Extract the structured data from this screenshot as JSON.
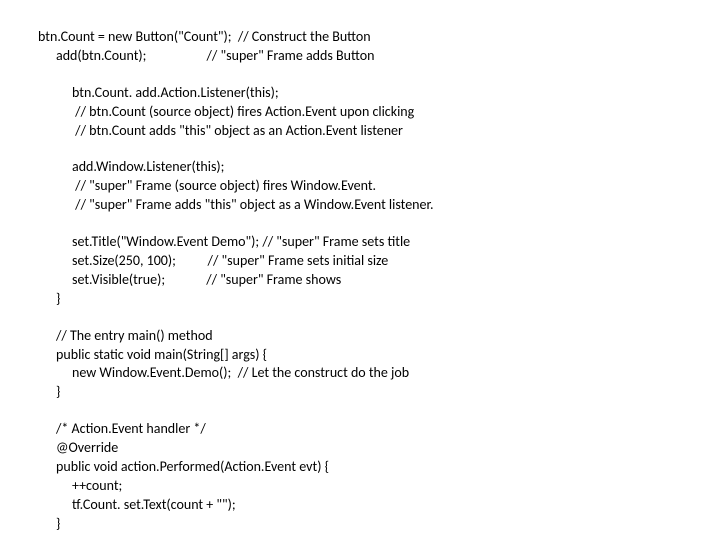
{
  "lines": [
    {
      "cls": "line",
      "text": "btn.Count = new Button(\"Count\");  // Construct the Button"
    },
    {
      "cls": "line ind1",
      "text": "add(btn.Count);                   // \"super\" Frame adds Button"
    },
    {
      "cls": "blank",
      "text": ""
    },
    {
      "cls": "line ind2",
      "text": "btn.Count. add.Action.Listener(this);"
    },
    {
      "cls": "line ind2",
      "text": " // btn.Count (source object) fires Action.Event upon clicking"
    },
    {
      "cls": "line ind2",
      "text": " // btn.Count adds \"this\" object as an Action.Event listener"
    },
    {
      "cls": "blank",
      "text": ""
    },
    {
      "cls": "line ind2",
      "text": "add.Window.Listener(this);"
    },
    {
      "cls": "line ind2",
      "text": " // \"super\" Frame (source object) fires Window.Event."
    },
    {
      "cls": "line ind2",
      "text": " // \"super\" Frame adds \"this\" object as a Window.Event listener."
    },
    {
      "cls": "blank",
      "text": ""
    },
    {
      "cls": "line ind2",
      "text": "set.Title(\"Window.Event Demo\"); // \"super\" Frame sets title"
    },
    {
      "cls": "line ind2",
      "text": "set.Size(250, 100);          // \"super\" Frame sets initial size"
    },
    {
      "cls": "line ind2",
      "text": "set.Visible(true);             // \"super\" Frame shows"
    },
    {
      "cls": "line ind1",
      "text": "}"
    },
    {
      "cls": "blank",
      "text": ""
    },
    {
      "cls": "line ind1",
      "text": "// The entry main() method"
    },
    {
      "cls": "line ind1",
      "text": "public static void main(String[] args) {"
    },
    {
      "cls": "line ind2",
      "text": "new Window.Event.Demo();  // Let the construct do the job"
    },
    {
      "cls": "line ind1",
      "text": "}"
    },
    {
      "cls": "blank",
      "text": ""
    },
    {
      "cls": "line ind1",
      "text": "/* Action.Event handler */"
    },
    {
      "cls": "line ind1",
      "text": "@Override"
    },
    {
      "cls": "line ind1",
      "text": "public void action.Performed(Action.Event evt) {"
    },
    {
      "cls": "line ind2",
      "text": "++count;"
    },
    {
      "cls": "line ind2",
      "text": "tf.Count. set.Text(count + \"\");"
    },
    {
      "cls": "line ind1",
      "text": "}"
    }
  ]
}
